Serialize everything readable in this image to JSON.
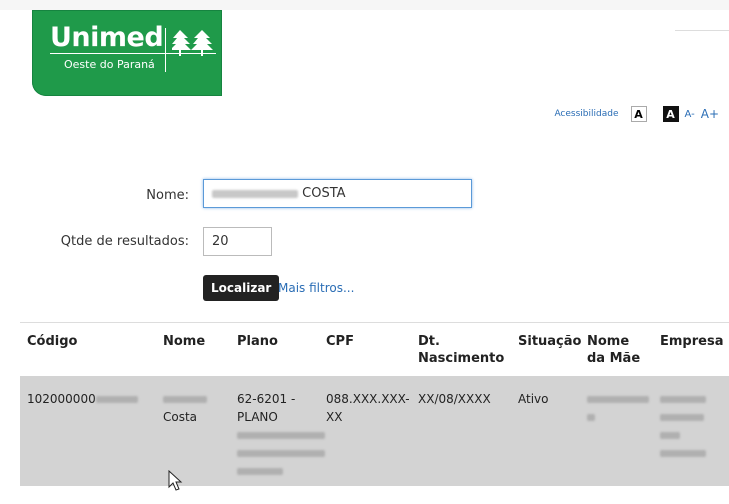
{
  "logo": {
    "brand": "Unimed",
    "subtitle": "Oeste do Paraná"
  },
  "accessibility": {
    "label": "Acessibilidade",
    "contrast_light": "A",
    "contrast_dark": "A",
    "font_decrease": "A-",
    "font_increase": "A+"
  },
  "form": {
    "nome_label": "Nome:",
    "nome_value": "COSTA",
    "qtde_label": "Qtde de resultados:",
    "qtde_value": "20",
    "search_button": "Localizar",
    "more_filters": "Mais filtros..."
  },
  "table": {
    "headers": [
      "Código",
      "Nome",
      "Plano",
      "CPF",
      "Dt. Nascimento",
      "Situação",
      "Nome da Mãe",
      "Empresa"
    ],
    "row": {
      "codigo": "102000000",
      "nome": "Costa",
      "plano_line1": "62-6201 -",
      "plano_line2": "PLANO",
      "cpf_line1": "088.XXX.XXX-",
      "cpf_line2": "XX",
      "nascimento": "XX/08/XXXX",
      "situacao": "Ativo"
    }
  },
  "colors": {
    "brand_green": "#1f9a4a",
    "link_blue": "#2a6db5",
    "row_gray": "#d3d3d3"
  }
}
